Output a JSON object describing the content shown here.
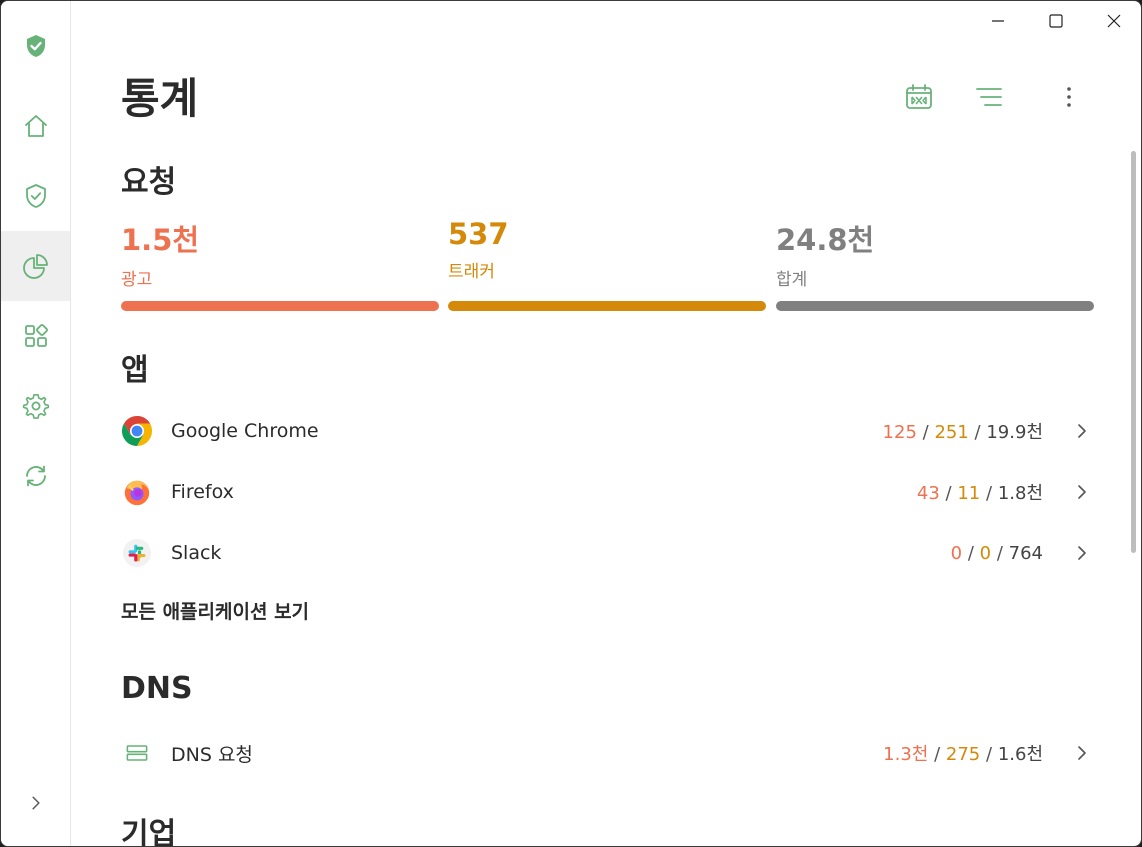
{
  "window": {
    "controls": [
      "minimize",
      "maximize",
      "close"
    ]
  },
  "colors": {
    "accent": "#67b279",
    "ads": "#ee7150",
    "trackers": "#d4890a",
    "total": "#808080"
  },
  "sidebar": {
    "items": [
      {
        "icon": "shield-check-filled-icon"
      },
      {
        "icon": "home-icon"
      },
      {
        "icon": "shield-check-icon"
      },
      {
        "icon": "pie-chart-icon",
        "active": true
      },
      {
        "icon": "apps-grid-icon"
      },
      {
        "icon": "gear-icon"
      },
      {
        "icon": "refresh-icon"
      }
    ],
    "expand_icon": "chevron-right-icon"
  },
  "header": {
    "title": "통계",
    "tools": [
      "calendar-icon",
      "filter-icon",
      "more-vertical-icon"
    ]
  },
  "requests": {
    "title": "요청",
    "stats": [
      {
        "value": "1.5천",
        "label": "광고"
      },
      {
        "value": "537",
        "label": "트래커"
      },
      {
        "value": "24.8천",
        "label": "합계"
      }
    ]
  },
  "apps": {
    "title": "앱",
    "rows": [
      {
        "name": "Google Chrome",
        "ads": "125",
        "trackers": "251",
        "total": "19.9천"
      },
      {
        "name": "Firefox",
        "ads": "43",
        "trackers": "11",
        "total": "1.8천"
      },
      {
        "name": "Slack",
        "ads": "0",
        "trackers": "0",
        "total": "764"
      }
    ],
    "separator": "/",
    "view_all": "모든 애플리케이션 보기"
  },
  "dns": {
    "title": "DNS",
    "rows": [
      {
        "name": "DNS 요청",
        "ads": "1.3천",
        "trackers": "275",
        "total": "1.6천"
      }
    ]
  },
  "companies": {
    "title": "기업"
  }
}
